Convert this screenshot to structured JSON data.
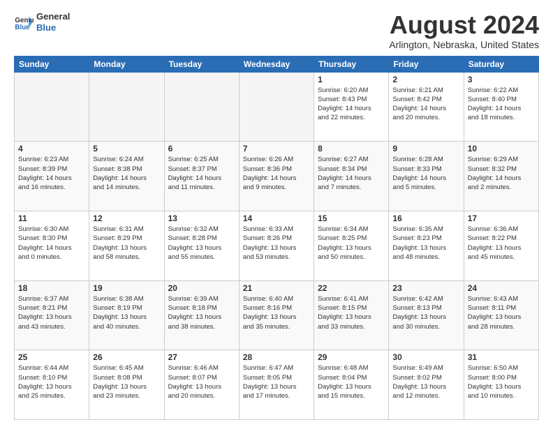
{
  "logo": {
    "line1": "General",
    "line2": "Blue"
  },
  "title": "August 2024",
  "location": "Arlington, Nebraska, United States",
  "days_of_week": [
    "Sunday",
    "Monday",
    "Tuesday",
    "Wednesday",
    "Thursday",
    "Friday",
    "Saturday"
  ],
  "weeks": [
    [
      {
        "num": "",
        "info": "",
        "empty": true
      },
      {
        "num": "",
        "info": "",
        "empty": true
      },
      {
        "num": "",
        "info": "",
        "empty": true
      },
      {
        "num": "",
        "info": "",
        "empty": true
      },
      {
        "num": "1",
        "info": "Sunrise: 6:20 AM\nSunset: 8:43 PM\nDaylight: 14 hours\nand 22 minutes.",
        "empty": false
      },
      {
        "num": "2",
        "info": "Sunrise: 6:21 AM\nSunset: 8:42 PM\nDaylight: 14 hours\nand 20 minutes.",
        "empty": false
      },
      {
        "num": "3",
        "info": "Sunrise: 6:22 AM\nSunset: 8:40 PM\nDaylight: 14 hours\nand 18 minutes.",
        "empty": false
      }
    ],
    [
      {
        "num": "4",
        "info": "Sunrise: 6:23 AM\nSunset: 8:39 PM\nDaylight: 14 hours\nand 16 minutes.",
        "empty": false
      },
      {
        "num": "5",
        "info": "Sunrise: 6:24 AM\nSunset: 8:38 PM\nDaylight: 14 hours\nand 14 minutes.",
        "empty": false
      },
      {
        "num": "6",
        "info": "Sunrise: 6:25 AM\nSunset: 8:37 PM\nDaylight: 14 hours\nand 11 minutes.",
        "empty": false
      },
      {
        "num": "7",
        "info": "Sunrise: 6:26 AM\nSunset: 8:36 PM\nDaylight: 14 hours\nand 9 minutes.",
        "empty": false
      },
      {
        "num": "8",
        "info": "Sunrise: 6:27 AM\nSunset: 8:34 PM\nDaylight: 14 hours\nand 7 minutes.",
        "empty": false
      },
      {
        "num": "9",
        "info": "Sunrise: 6:28 AM\nSunset: 8:33 PM\nDaylight: 14 hours\nand 5 minutes.",
        "empty": false
      },
      {
        "num": "10",
        "info": "Sunrise: 6:29 AM\nSunset: 8:32 PM\nDaylight: 14 hours\nand 2 minutes.",
        "empty": false
      }
    ],
    [
      {
        "num": "11",
        "info": "Sunrise: 6:30 AM\nSunset: 8:30 PM\nDaylight: 14 hours\nand 0 minutes.",
        "empty": false
      },
      {
        "num": "12",
        "info": "Sunrise: 6:31 AM\nSunset: 8:29 PM\nDaylight: 13 hours\nand 58 minutes.",
        "empty": false
      },
      {
        "num": "13",
        "info": "Sunrise: 6:32 AM\nSunset: 8:28 PM\nDaylight: 13 hours\nand 55 minutes.",
        "empty": false
      },
      {
        "num": "14",
        "info": "Sunrise: 6:33 AM\nSunset: 8:26 PM\nDaylight: 13 hours\nand 53 minutes.",
        "empty": false
      },
      {
        "num": "15",
        "info": "Sunrise: 6:34 AM\nSunset: 8:25 PM\nDaylight: 13 hours\nand 50 minutes.",
        "empty": false
      },
      {
        "num": "16",
        "info": "Sunrise: 6:35 AM\nSunset: 8:23 PM\nDaylight: 13 hours\nand 48 minutes.",
        "empty": false
      },
      {
        "num": "17",
        "info": "Sunrise: 6:36 AM\nSunset: 8:22 PM\nDaylight: 13 hours\nand 45 minutes.",
        "empty": false
      }
    ],
    [
      {
        "num": "18",
        "info": "Sunrise: 6:37 AM\nSunset: 8:21 PM\nDaylight: 13 hours\nand 43 minutes.",
        "empty": false
      },
      {
        "num": "19",
        "info": "Sunrise: 6:38 AM\nSunset: 8:19 PM\nDaylight: 13 hours\nand 40 minutes.",
        "empty": false
      },
      {
        "num": "20",
        "info": "Sunrise: 6:39 AM\nSunset: 8:18 PM\nDaylight: 13 hours\nand 38 minutes.",
        "empty": false
      },
      {
        "num": "21",
        "info": "Sunrise: 6:40 AM\nSunset: 8:16 PM\nDaylight: 13 hours\nand 35 minutes.",
        "empty": false
      },
      {
        "num": "22",
        "info": "Sunrise: 6:41 AM\nSunset: 8:15 PM\nDaylight: 13 hours\nand 33 minutes.",
        "empty": false
      },
      {
        "num": "23",
        "info": "Sunrise: 6:42 AM\nSunset: 8:13 PM\nDaylight: 13 hours\nand 30 minutes.",
        "empty": false
      },
      {
        "num": "24",
        "info": "Sunrise: 6:43 AM\nSunset: 8:11 PM\nDaylight: 13 hours\nand 28 minutes.",
        "empty": false
      }
    ],
    [
      {
        "num": "25",
        "info": "Sunrise: 6:44 AM\nSunset: 8:10 PM\nDaylight: 13 hours\nand 25 minutes.",
        "empty": false
      },
      {
        "num": "26",
        "info": "Sunrise: 6:45 AM\nSunset: 8:08 PM\nDaylight: 13 hours\nand 23 minutes.",
        "empty": false
      },
      {
        "num": "27",
        "info": "Sunrise: 6:46 AM\nSunset: 8:07 PM\nDaylight: 13 hours\nand 20 minutes.",
        "empty": false
      },
      {
        "num": "28",
        "info": "Sunrise: 6:47 AM\nSunset: 8:05 PM\nDaylight: 13 hours\nand 17 minutes.",
        "empty": false
      },
      {
        "num": "29",
        "info": "Sunrise: 6:48 AM\nSunset: 8:04 PM\nDaylight: 13 hours\nand 15 minutes.",
        "empty": false
      },
      {
        "num": "30",
        "info": "Sunrise: 6:49 AM\nSunset: 8:02 PM\nDaylight: 13 hours\nand 12 minutes.",
        "empty": false
      },
      {
        "num": "31",
        "info": "Sunrise: 6:50 AM\nSunset: 8:00 PM\nDaylight: 13 hours\nand 10 minutes.",
        "empty": false
      }
    ]
  ]
}
